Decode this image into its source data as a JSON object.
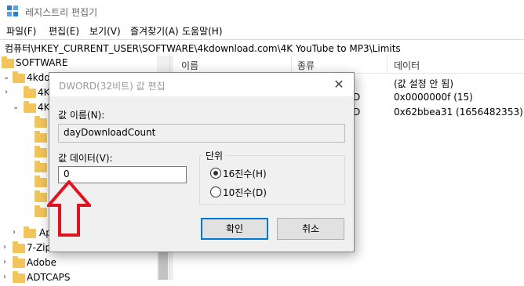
{
  "window": {
    "title": "레지스트리 편집기"
  },
  "menu": [
    "파일(F)",
    "편집(E)",
    "보기(V)",
    "즐겨찾기(A)",
    "도움말(H)"
  ],
  "address": "컴퓨터\\HKEY_CURRENT_USER\\SOFTWARE\\4kdownload.com\\4K YouTube to MP3\\Limits",
  "tree": {
    "items": [
      "SOFTWARE",
      "4kdownload",
      "4K",
      "4K",
      "Ap",
      "7-Zip",
      "Adobe",
      "ADTCAPS"
    ]
  },
  "list": {
    "columns": [
      "이름",
      "종류",
      "데이터"
    ],
    "rows": [
      {
        "type_fragment": "",
        "data": "(값 설정 안 됨)"
      },
      {
        "type_fragment": "D",
        "data": "0x0000000f (15)"
      },
      {
        "type_fragment": "D",
        "data": "0x62bbea31 (1656482353)"
      }
    ]
  },
  "dialog": {
    "title": "DWORD(32비트) 값 편집",
    "close_glyph": "✕",
    "value_name_label": "값 이름(N):",
    "value_name": "dayDownloadCount",
    "value_data_label": "값 데이터(V):",
    "value_data": "0",
    "base_label": "단위",
    "base_options": [
      {
        "label": "16진수(H)",
        "selected": true
      },
      {
        "label": "10진수(D)",
        "selected": false
      }
    ],
    "ok_label": "확인",
    "cancel_label": "취소"
  },
  "colors": {
    "folder": "#f2c45c",
    "annotation_arrow": "#e0141e",
    "accent": "#0078d7"
  }
}
